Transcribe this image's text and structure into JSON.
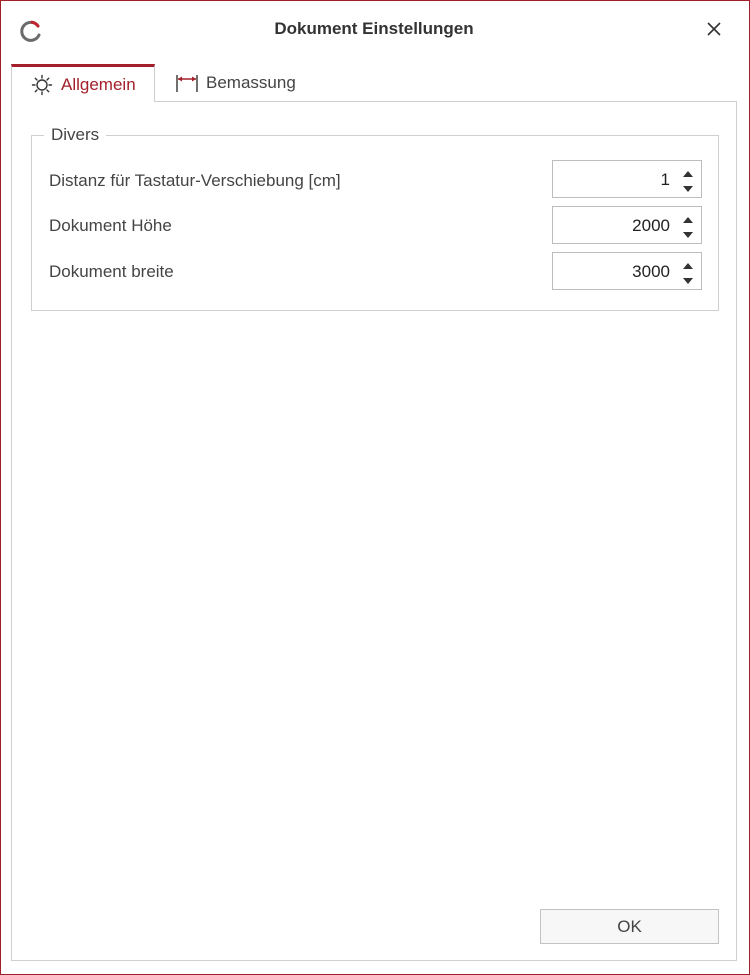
{
  "window": {
    "title": "Dokument Einstellungen",
    "accent_color": "#a3202a"
  },
  "icons": {
    "app": "app-logo-icon",
    "close": "close-icon",
    "tab_general": "sun-icon",
    "tab_dimension": "dimension-icon"
  },
  "tabs": [
    {
      "label": "Allgemein",
      "active": true
    },
    {
      "label": "Bemassung",
      "active": false
    }
  ],
  "group": {
    "legend": "Divers",
    "rows": [
      {
        "label": "Distanz für Tastatur-Verschiebung [cm]",
        "value": "1"
      },
      {
        "label": "Dokument Höhe",
        "value": "2000"
      },
      {
        "label": "Dokument breite",
        "value": "3000"
      }
    ]
  },
  "footer": {
    "ok_label": "OK"
  }
}
